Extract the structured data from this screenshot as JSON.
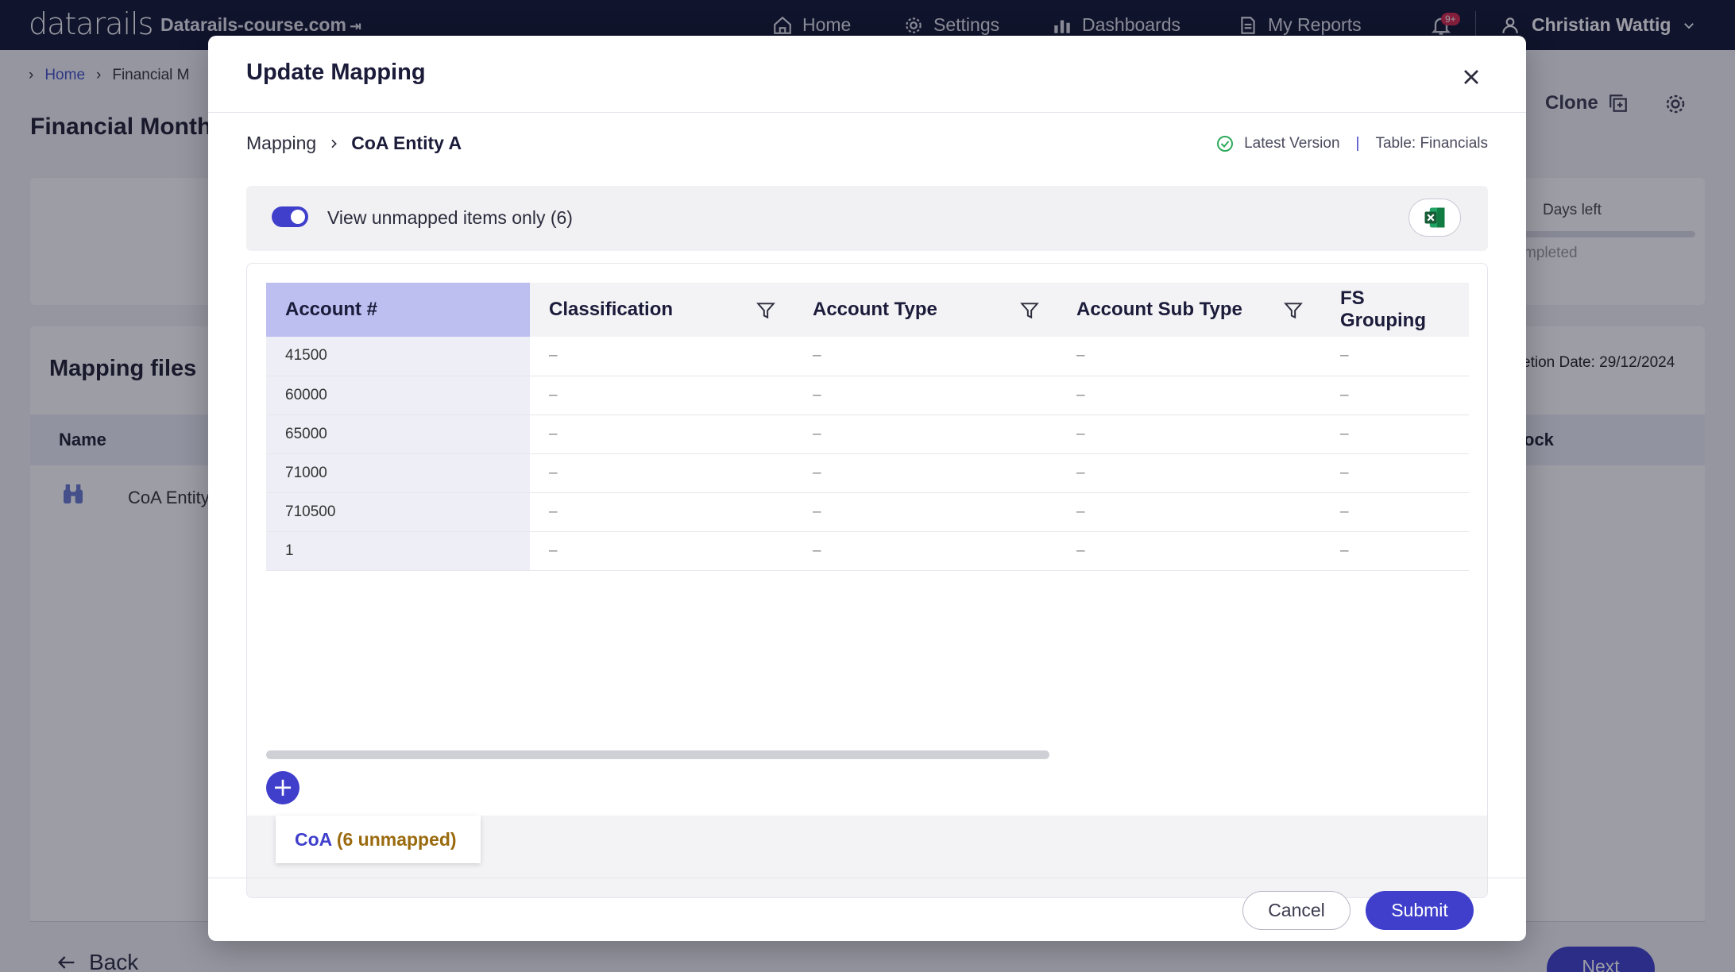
{
  "topbar": {
    "logo": "datarails",
    "company": "Datarails-course.com",
    "nav": [
      {
        "label": "Home",
        "icon": "home-icon"
      },
      {
        "label": "Settings",
        "icon": "gear-icon"
      },
      {
        "label": "Dashboards",
        "icon": "bar-chart-icon"
      },
      {
        "label": "My Reports",
        "icon": "report-icon"
      }
    ],
    "notifications_badge": "9+",
    "user_name": "Christian Wattig"
  },
  "background": {
    "breadcrumb_home": "Home",
    "breadcrumb_current": "Financial M",
    "page_title": "Financial Month",
    "clone_label": "Clone",
    "days_left": "Days left",
    "completed": "mpleted",
    "completion_date": "etion Date: 29/12/2024",
    "mapping_files_title": "Mapping files",
    "col_name": "Name",
    "col_lock": "ock",
    "row_name": "CoA Entity",
    "back_label": "Back",
    "next_label": "Next"
  },
  "modal": {
    "title": "Update Mapping",
    "breadcrumb": [
      "Mapping",
      "CoA Entity A"
    ],
    "version_label": "Latest Version",
    "table_label": "Table: Financials",
    "toggle_label": "View unmapped items only (6)",
    "toggle_on": true,
    "columns": [
      "Account #",
      "Classification",
      "Account Type",
      "Account Sub Type",
      "FS Grouping"
    ],
    "rows": [
      [
        "41500",
        "–",
        "–",
        "–",
        "–"
      ],
      [
        "60000",
        "–",
        "–",
        "–",
        "–"
      ],
      [
        "65000",
        "–",
        "–",
        "–",
        "–"
      ],
      [
        "71000",
        "–",
        "–",
        "–",
        "–"
      ],
      [
        "710500",
        "–",
        "–",
        "–",
        "–"
      ],
      [
        "1",
        "–",
        "–",
        "–",
        "–"
      ]
    ],
    "sheet_tab_name": "CoA",
    "sheet_tab_count": "(6 unmapped)",
    "cancel_label": "Cancel",
    "submit_label": "Submit"
  },
  "colors": {
    "accent": "#3f3fcc",
    "topbar": "#0f1430",
    "account_header": "#bcbff0",
    "success": "#2eaa5c",
    "excel": "#1d7a43"
  }
}
